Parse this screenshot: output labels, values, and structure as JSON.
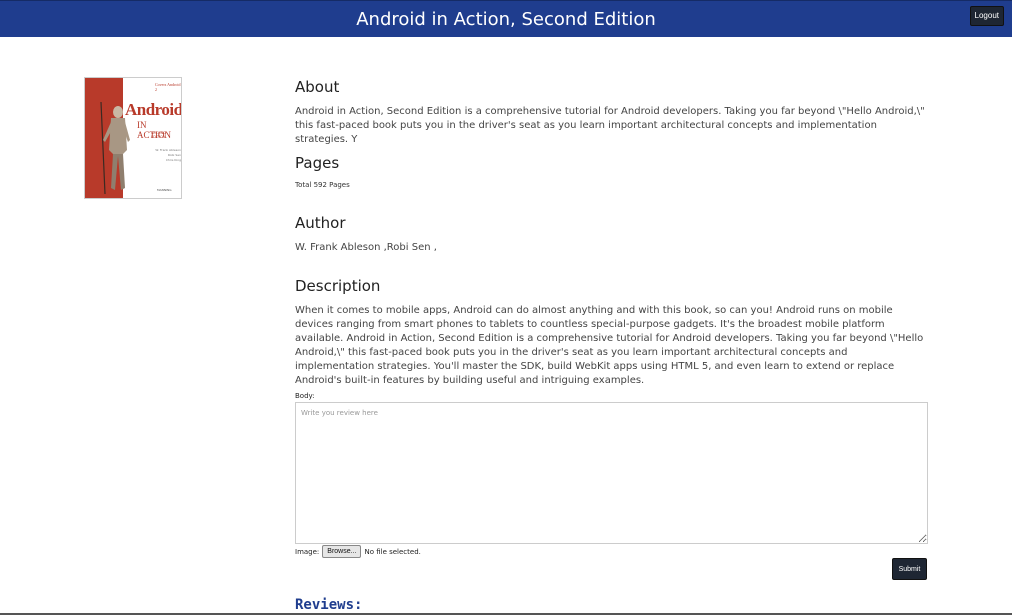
{
  "header": {
    "title": "Android in Action, Second Edition",
    "logout_label": "Logout"
  },
  "cover": {
    "small_text": "Covers Android 2",
    "main_text": "Android",
    "sub_text": "IN ACTION",
    "edition_text": "SECOND EDITION",
    "author_lines": [
      "W. Frank Ableson",
      "Robi Sen",
      "Chris King"
    ],
    "publisher": "MANNING"
  },
  "about": {
    "heading": "About",
    "text": "Android in Action, Second Edition is a comprehensive tutorial for Android developers. Taking you far beyond \\\"Hello Android,\\\" this fast-paced book puts you in the driver's seat as you learn important architectural concepts and implementation strategies. Y"
  },
  "pages": {
    "heading": "Pages",
    "text": "Total 592 Pages"
  },
  "author": {
    "heading": "Author",
    "text": "W. Frank Ableson ,Robi Sen ,"
  },
  "description": {
    "heading": "Description",
    "text": "When it comes to mobile apps, Android can do almost anything and with this book, so can you! Android runs on mobile devices ranging from smart phones to tablets to countless special-purpose gadgets. It's the broadest mobile platform available. Android in Action, Second Edition is a comprehensive tutorial for Android developers. Taking you far beyond \\\"Hello Android,\\\" this fast-paced book puts you in the driver's seat as you learn important architectural concepts and implementation strategies. You'll master the SDK, build WebKit apps using HTML 5, and even learn to extend or replace Android's built-in features by building useful and intriguing examples."
  },
  "review_form": {
    "body_label": "Body:",
    "body_placeholder": "Write you review here",
    "image_label": "Image:",
    "browse_label": "Browse...",
    "file_status": "No file selected.",
    "submit_label": "Submit"
  },
  "reviews": {
    "heading": "Reviews:"
  },
  "colors": {
    "header_bg": "#1f3d8e",
    "button_bg": "#1e2633",
    "cover_red": "#b83a2a"
  }
}
